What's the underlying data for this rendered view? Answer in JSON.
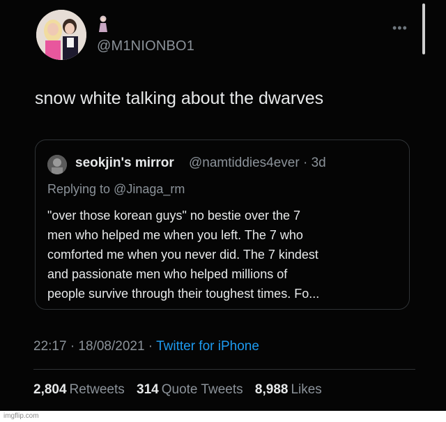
{
  "tweet": {
    "avatar_icon": "profile-photo-icon",
    "name_icon": "doll-emoji-icon",
    "handle": "@M1NIONBO1",
    "more_icon": "more-options-icon",
    "text": "snow white talking about the dwarves"
  },
  "quote": {
    "avatar_icon": "profile-photo-icon",
    "name": "seokjin's mirror",
    "handle_time": "@namtiddies4ever · 3d",
    "replying_to": "Replying to @Jinaga_rm",
    "body_lines": [
      "\"over those korean guys\" no bestie over the 7",
      "men who helped me when you left. The 7 who",
      "comforted me when you never did. The 7 kindest",
      "and passionate men who helped millions of",
      "people survive through their toughest times. Fo..."
    ]
  },
  "meta": {
    "time_date": "22:17 · 18/08/2021 · ",
    "source": "Twitter for iPhone"
  },
  "stats": {
    "retweets_count": "2,804",
    "retweets_label": "Retweets",
    "quotes_count": "314",
    "quotes_label": "Quote Tweets",
    "likes_count": "8,988",
    "likes_label": "Likes"
  },
  "watermark": "imgflip.com",
  "colors": {
    "background": "#050505",
    "text": "#e7e9ea",
    "secondary": "#8b9299",
    "link": "#1d9bf0",
    "border": "#2f3336"
  }
}
